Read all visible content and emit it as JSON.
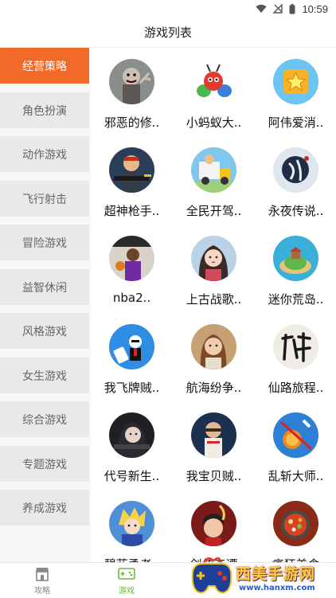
{
  "status_bar": {
    "time": "10:59"
  },
  "header": {
    "title": "游戏列表"
  },
  "categories": [
    {
      "label": "经营策略",
      "active": true
    },
    {
      "label": "角色扮演"
    },
    {
      "label": "动作游戏"
    },
    {
      "label": "飞行射击"
    },
    {
      "label": "冒险游戏"
    },
    {
      "label": "益智休闲"
    },
    {
      "label": "风格游戏"
    },
    {
      "label": "女生游戏"
    },
    {
      "label": "综合游戏"
    },
    {
      "label": "专题游戏"
    },
    {
      "label": "养成游戏"
    }
  ],
  "games": [
    {
      "name": "邪恶的修..",
      "icon": "zombie-icon"
    },
    {
      "name": "小蚂蚁大..",
      "icon": "ant-icon"
    },
    {
      "name": "阿伟爱消..",
      "icon": "star-cube-icon"
    },
    {
      "name": "超神枪手..",
      "icon": "gunner-icon"
    },
    {
      "name": "全民开驾..",
      "icon": "truck-icon"
    },
    {
      "name": "永夜传说..",
      "icon": "moon-night-icon"
    },
    {
      "name": "nba2..",
      "icon": "basketball-player-icon"
    },
    {
      "name": "上古战歌..",
      "icon": "heroine-icon"
    },
    {
      "name": "迷你荒岛..",
      "icon": "island-icon"
    },
    {
      "name": "我飞牌贼..",
      "icon": "card-thief-icon"
    },
    {
      "name": "航海纷争..",
      "icon": "sailor-girl-icon"
    },
    {
      "name": "仙路旅程..",
      "icon": "xianlu-calligraphy-icon"
    },
    {
      "name": "代号新生..",
      "icon": "reborn-girl-icon"
    },
    {
      "name": "我宝贝贼..",
      "icon": "thief-icon"
    },
    {
      "name": "乱斩大师..",
      "icon": "fruit-slash-icon"
    },
    {
      "name": "碧蓝勇者..",
      "icon": "hero-boy-icon"
    },
    {
      "name": "剑侠奇谭",
      "icon": "swordsman-icon"
    },
    {
      "name": "疯狂美食",
      "icon": "hotpot-icon"
    }
  ],
  "tabs": [
    {
      "label": "攻略",
      "icon": "shop-icon"
    },
    {
      "label": "游戏",
      "icon": "gamepad-icon",
      "active": true
    }
  ],
  "watermark": {
    "logo_text": "西美手游网",
    "url": "www.hanxm.com"
  },
  "colors": {
    "accent": "#f26a2a",
    "tab_active": "#6bb843",
    "sidebar_item": "#e9e9e9"
  }
}
